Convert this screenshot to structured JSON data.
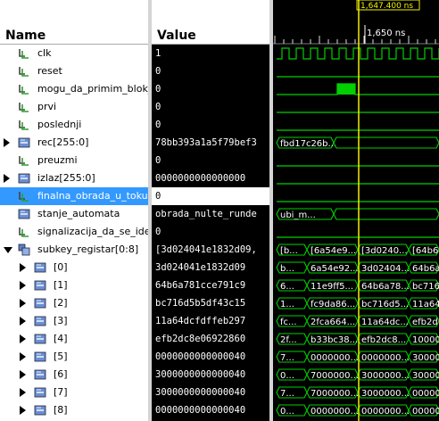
{
  "columns": {
    "name": "Name",
    "value": "Value"
  },
  "timeline": {
    "cursor_label": "1,647.400 ns",
    "tick_label": "1,650 ns"
  },
  "signals": [
    {
      "name": "clk",
      "value": "1",
      "type": "bit",
      "expandable": false,
      "indent": 0
    },
    {
      "name": "reset",
      "value": "0",
      "type": "bit",
      "expandable": false,
      "indent": 0
    },
    {
      "name": "mogu_da_primim_blok_",
      "value": "0",
      "type": "bit",
      "expandable": false,
      "indent": 0
    },
    {
      "name": "prvi",
      "value": "0",
      "type": "bit",
      "expandable": false,
      "indent": 0
    },
    {
      "name": "poslednji",
      "value": "0",
      "type": "bit",
      "expandable": false,
      "indent": 0
    },
    {
      "name": "rec[255:0]",
      "value": "78bb393a1a5f79bef3",
      "type": "bus",
      "expandable": true,
      "indent": 0
    },
    {
      "name": "preuzmi",
      "value": "0",
      "type": "bit",
      "expandable": false,
      "indent": 0
    },
    {
      "name": "izlaz[255:0]",
      "value": "0000000000000000",
      "type": "bus",
      "expandable": true,
      "indent": 0
    },
    {
      "name": "finalna_obrada_u_toku",
      "value": "0",
      "type": "bit",
      "expandable": false,
      "indent": 0,
      "selected": true
    },
    {
      "name": "stanje_automata",
      "value": "obrada_nulte_runde",
      "type": "bus",
      "expandable": false,
      "indent": 0
    },
    {
      "name": "signalizacija_da_se_ide_",
      "value": "0",
      "type": "bit",
      "expandable": false,
      "indent": 0
    },
    {
      "name": "subkey_registar[0:8]",
      "value": "[3d024041e1832d09,",
      "type": "array",
      "expandable": true,
      "expanded": true,
      "indent": 0
    },
    {
      "name": "[0]",
      "value": "3d024041e1832d09",
      "type": "bus",
      "expandable": true,
      "indent": 1
    },
    {
      "name": "[1]",
      "value": "64b6a781cce791c9",
      "type": "bus",
      "expandable": true,
      "indent": 1
    },
    {
      "name": "[2]",
      "value": "bc716d5b5df43c15",
      "type": "bus",
      "expandable": true,
      "indent": 1
    },
    {
      "name": "[3]",
      "value": "11a64dcfdffeb297",
      "type": "bus",
      "expandable": true,
      "indent": 1
    },
    {
      "name": "[4]",
      "value": "efb2dc8e06922860",
      "type": "bus",
      "expandable": true,
      "indent": 1
    },
    {
      "name": "[5]",
      "value": "0000000000000040",
      "type": "bus",
      "expandable": true,
      "indent": 1
    },
    {
      "name": "[6]",
      "value": "3000000000000040",
      "type": "bus",
      "expandable": true,
      "indent": 1
    },
    {
      "name": "[7]",
      "value": "3000000000000040",
      "type": "bus",
      "expandable": true,
      "indent": 1
    },
    {
      "name": "[8]",
      "value": "0000000000000040",
      "type": "bus",
      "expandable": true,
      "indent": 1
    }
  ],
  "waves": [
    {
      "kind": "clock"
    },
    {
      "kind": "low"
    },
    {
      "kind": "pulse"
    },
    {
      "kind": "low"
    },
    {
      "kind": "low"
    },
    {
      "kind": "bus",
      "labels": [
        "fbd17c26b..."
      ]
    },
    {
      "kind": "low"
    },
    {
      "kind": "low"
    },
    {
      "kind": "low"
    },
    {
      "kind": "bus",
      "labels": [
        "ubi_m..."
      ]
    },
    {
      "kind": "low"
    },
    {
      "kind": "bus",
      "labels": [
        "[b...",
        "[6a54e9...",
        "[3d0240...",
        "[64b6a"
      ]
    },
    {
      "kind": "bus",
      "labels": [
        "b...",
        "6a54e92...",
        "3d02404...",
        "64b6a"
      ]
    },
    {
      "kind": "bus",
      "labels": [
        "6...",
        "11e9ff5...",
        "64b6a78...",
        "bc716"
      ]
    },
    {
      "kind": "bus",
      "labels": [
        "1...",
        "fc9da86...",
        "bc716d5...",
        "11a64"
      ]
    },
    {
      "kind": "bus",
      "labels": [
        "fc...",
        "2fca664...",
        "11a64dc...",
        "efb2d"
      ]
    },
    {
      "kind": "bus",
      "labels": [
        "2f...",
        "b33bc38...",
        "efb2dc8...",
        "10000"
      ]
    },
    {
      "kind": "bus",
      "labels": [
        "7...",
        "0000000...",
        "0000000...",
        "30000"
      ]
    },
    {
      "kind": "bus",
      "labels": [
        "0...",
        "7000000...",
        "3000000...",
        "30000"
      ]
    },
    {
      "kind": "bus",
      "labels": [
        "7...",
        "7000000...",
        "3000000...",
        "00000"
      ]
    },
    {
      "kind": "bus",
      "labels": [
        "0...",
        "0000000...",
        "0000000...",
        "00000"
      ]
    }
  ],
  "colors": {
    "wave": "#00d000",
    "cursor": "#f2f200",
    "selection": "#3399ff"
  }
}
